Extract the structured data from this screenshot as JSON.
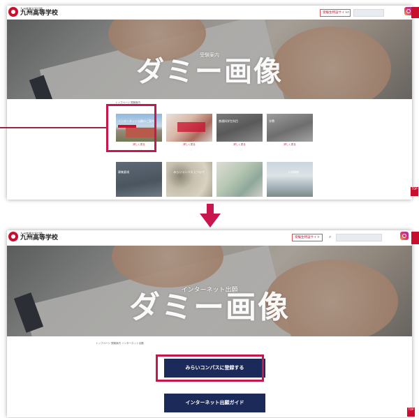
{
  "site": {
    "logo_sub": "九州産業大学付属",
    "logo_main": "九州高等学校",
    "header_button": "受験生特設サイト",
    "search_icon": "search-icon",
    "instagram_icon": "instagram-icon",
    "menu_icon": "hamburger-menu-icon"
  },
  "top_panel": {
    "hero_title": "受験案内",
    "breadcrumb": "トップページ 受験案内",
    "tiles": [
      {
        "label": "インターネット出願のご案内",
        "link": "詳しく見る"
      },
      {
        "label": "",
        "link": "詳しく見る"
      },
      {
        "label": "普通科学生科目",
        "link": "詳しく見る"
      },
      {
        "label": "学費",
        "link": "詳しく見る"
      },
      {
        "label": "募集要項",
        "link": ""
      },
      {
        "label": "みらいコンパス について",
        "link": ""
      },
      {
        "label": "",
        "link": ""
      },
      {
        "label": "入試情報",
        "link": ""
      }
    ],
    "to_top": "TOP"
  },
  "bottom_panel": {
    "hero_title": "インターネット出願",
    "breadcrumb": "トップページ 受験案内 インターネット出願",
    "buttons": [
      "みらいコンパスに登録する",
      "インターネット出願ガイド"
    ],
    "to_top": "TOP"
  },
  "overlay": {
    "dummy_text": "ダミー画像"
  },
  "colors": {
    "highlight": "#c8174c",
    "navy": "#1b2a59",
    "brand_red": "#c8102e"
  }
}
